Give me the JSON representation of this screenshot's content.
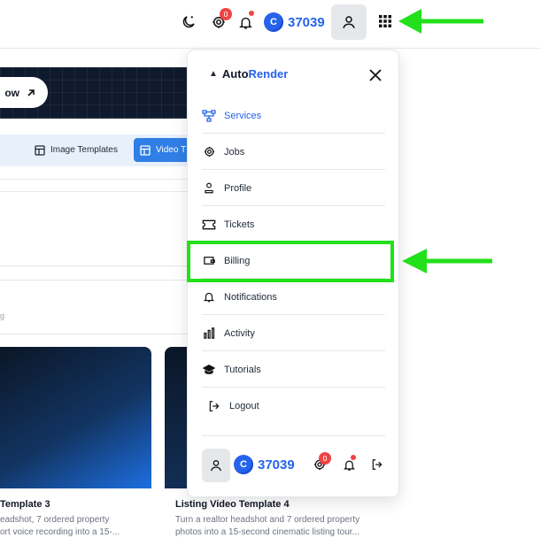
{
  "topbar": {
    "notif_count": "0",
    "credits": "37039",
    "coin_letter": "C",
    "icons": [
      "moon-icon",
      "support-icon",
      "bell-icon",
      "user-icon",
      "apps-grid-icon"
    ]
  },
  "background": {
    "banner_btn_label": "ow",
    "tabs": {
      "image": "Image Templates",
      "video": "Video T"
    },
    "small_text": "g",
    "cards": [
      {
        "title": "Template 3",
        "desc1": "eadshot, 7 ordered property",
        "desc2": "ort voice recording into a 15-..."
      },
      {
        "title": "Listing Video Template 4",
        "desc1": "Turn a realtor headshot and 7 ordered property",
        "desc2": "photos into a 15-second cinematic listing tour..."
      }
    ]
  },
  "panel": {
    "logo_auto": "Auto",
    "logo_render": "Render",
    "logo_mark": "▲",
    "items": [
      {
        "label": "Services",
        "icon": "services-icon"
      },
      {
        "label": "Jobs",
        "icon": "jobs-icon"
      },
      {
        "label": "Profile",
        "icon": "profile-icon"
      },
      {
        "label": "Tickets",
        "icon": "ticket-icon"
      },
      {
        "label": "Billing",
        "icon": "wallet-icon"
      },
      {
        "label": "Notifications",
        "icon": "bell-icon"
      },
      {
        "label": "Activity",
        "icon": "activity-icon"
      },
      {
        "label": "Tutorials",
        "icon": "graduation-cap-icon"
      },
      {
        "label": "Logout",
        "icon": "logout-icon"
      }
    ],
    "footer": {
      "credits": "37039",
      "coin_letter": "C",
      "notif_count": "0"
    }
  },
  "colors": {
    "accent": "#2563eb",
    "highlight": "#22e01a",
    "badge": "#ef4444"
  }
}
